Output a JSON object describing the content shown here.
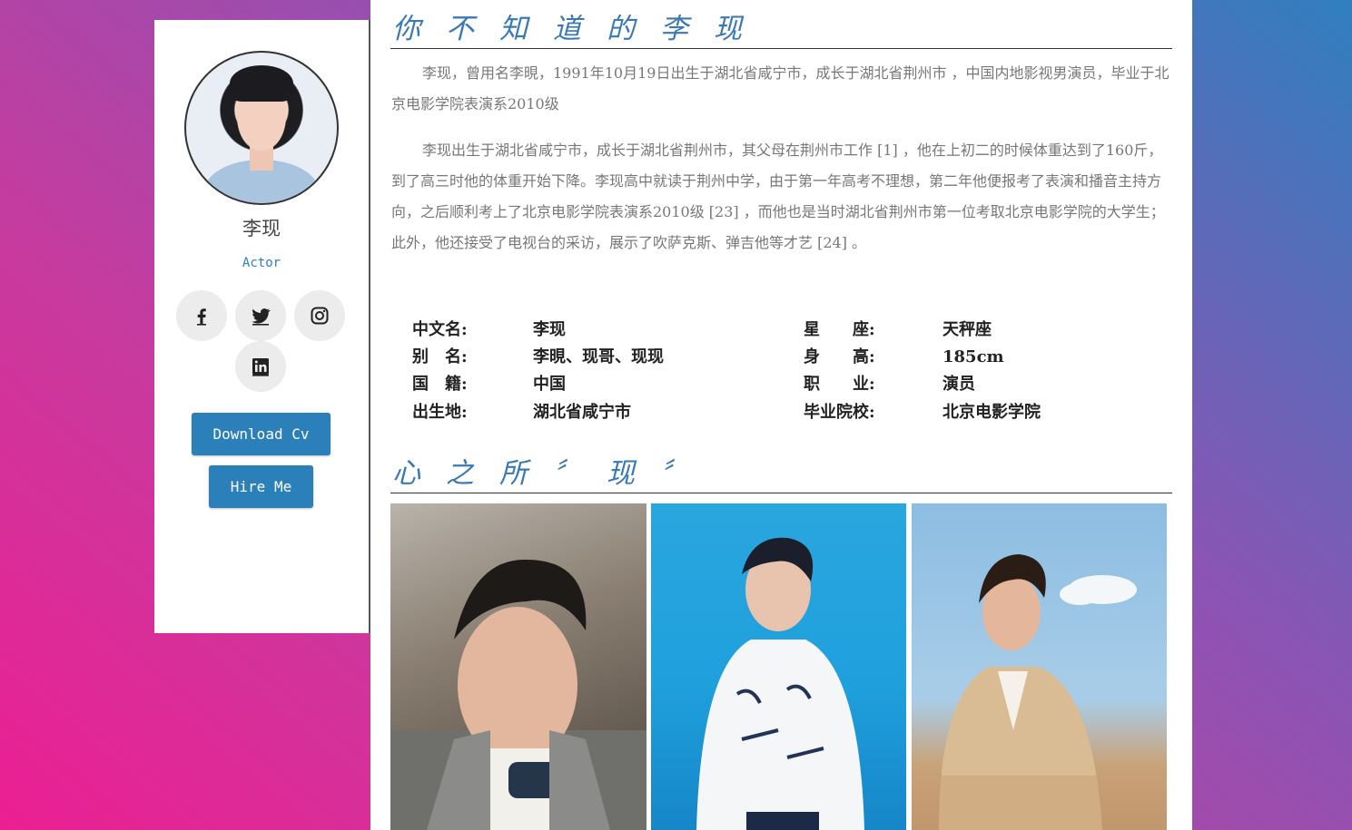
{
  "profile": {
    "name": "李现",
    "role": "Actor",
    "download_label": "Download Cv",
    "hire_label": "Hire Me"
  },
  "about": {
    "title": "你不知道的李现",
    "paragraphs": [
      "李现，曾用名李晛，1991年10月19日出生于湖北省咸宁市，成长于湖北省荆州市 ，中国内地影视男演员，毕业于北京电影学院表演系2010级",
      "李现出生于湖北省咸宁市，成长于湖北省荆州市，其父母在荆州市工作 [1] ，他在上初二的时候体重达到了160斤，到了高三时他的体重开始下降。李现高中就读于荆州中学，由于第一年高考不理想，第二年他便报考了表演和播音主持方向，之后顺利考上了北京电影学院表演系2010级 [23] ，而他也是当时湖北省荆州市第一位考取北京电影学院的大学生；此外，他还接受了电视台的采访，展示了吹萨克斯、弹吉他等才艺 [24] 。"
    ]
  },
  "info_left": [
    {
      "label": "中文名:",
      "value": "李现"
    },
    {
      "label": "别　名:",
      "value": "李晛、现哥、现现"
    },
    {
      "label": "国　籍:",
      "value": "中国"
    },
    {
      "label": "出生地:",
      "value": "湖北省咸宁市"
    }
  ],
  "info_right": [
    {
      "label": "星　　座:",
      "value": "天秤座"
    },
    {
      "label": "身　　高:",
      "value": "185cm"
    },
    {
      "label": "职　　业:",
      "value": "演员"
    },
    {
      "label": "毕业院校:",
      "value": "北京电影学院"
    }
  ],
  "gallery": {
    "title": "心之所〞现〞"
  },
  "colors": {
    "accent": "#2b80b9",
    "title": "#3a79b4"
  },
  "icons": [
    "facebook-icon",
    "twitter-icon",
    "instagram-icon",
    "linkedin-icon"
  ]
}
